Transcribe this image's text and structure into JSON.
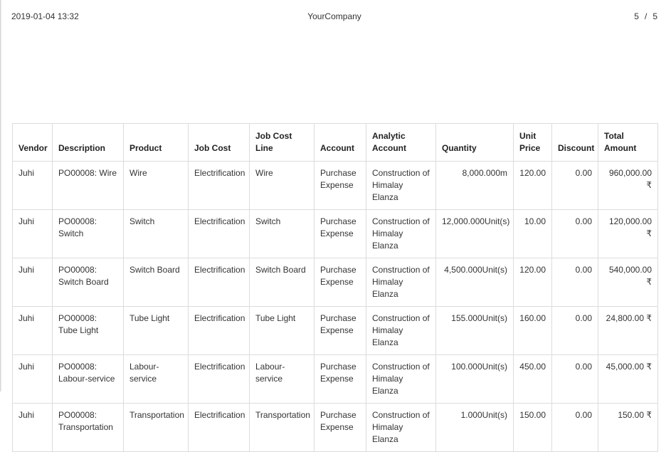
{
  "header": {
    "datetime": "2019-01-04 13:32",
    "company": "YourCompany",
    "page_current": "5",
    "page_separator": "/",
    "page_total": "5"
  },
  "table": {
    "columns": {
      "vendor": "Vendor",
      "description": "Description",
      "product": "Product",
      "job_cost": "Job Cost",
      "job_cost_line": "Job Cost Line",
      "account": "Account",
      "analytic_account": "Analytic Account",
      "quantity": "Quantity",
      "unit_price": "Unit Price",
      "discount": "Discount",
      "total_amount": "Total Amount"
    },
    "rows": [
      {
        "vendor": "Juhi",
        "description": "PO00008: Wire",
        "product": "Wire",
        "job_cost": "Electrification",
        "job_cost_line": "Wire",
        "account": "Purchase Expense",
        "analytic_account": "Construction of Himalay Elanza",
        "quantity": "8,000.000m",
        "unit_price": "120.00",
        "discount": "0.00",
        "total_amount": "960,000.00 ₹"
      },
      {
        "vendor": "Juhi",
        "description": "PO00008: Switch",
        "product": "Switch",
        "job_cost": "Electrification",
        "job_cost_line": "Switch",
        "account": "Purchase Expense",
        "analytic_account": "Construction of Himalay Elanza",
        "quantity": "12,000.000Unit(s)",
        "unit_price": "10.00",
        "discount": "0.00",
        "total_amount": "120,000.00 ₹"
      },
      {
        "vendor": "Juhi",
        "description": "PO00008: Switch Board",
        "product": "Switch Board",
        "job_cost": "Electrification",
        "job_cost_line": "Switch Board",
        "account": "Purchase Expense",
        "analytic_account": "Construction of Himalay Elanza",
        "quantity": "4,500.000Unit(s)",
        "unit_price": "120.00",
        "discount": "0.00",
        "total_amount": "540,000.00 ₹"
      },
      {
        "vendor": "Juhi",
        "description": "PO00008: Tube Light",
        "product": "Tube Light",
        "job_cost": "Electrification",
        "job_cost_line": "Tube Light",
        "account": "Purchase Expense",
        "analytic_account": "Construction of Himalay Elanza",
        "quantity": "155.000Unit(s)",
        "unit_price": "160.00",
        "discount": "0.00",
        "total_amount": "24,800.00 ₹"
      },
      {
        "vendor": "Juhi",
        "description": "PO00008: Labour-service",
        "product": "Labour-service",
        "job_cost": "Electrification",
        "job_cost_line": "Labour-service",
        "account": "Purchase Expense",
        "analytic_account": "Construction of Himalay Elanza",
        "quantity": "100.000Unit(s)",
        "unit_price": "450.00",
        "discount": "0.00",
        "total_amount": "45,000.00 ₹"
      },
      {
        "vendor": "Juhi",
        "description": "PO00008: Transportation",
        "product": "Transportation",
        "job_cost": "Electrification",
        "job_cost_line": "Transportation",
        "account": "Purchase Expense",
        "analytic_account": "Construction of Himalay Elanza",
        "quantity": "1.000Unit(s)",
        "unit_price": "150.00",
        "discount": "0.00",
        "total_amount": "150.00 ₹"
      }
    ]
  }
}
